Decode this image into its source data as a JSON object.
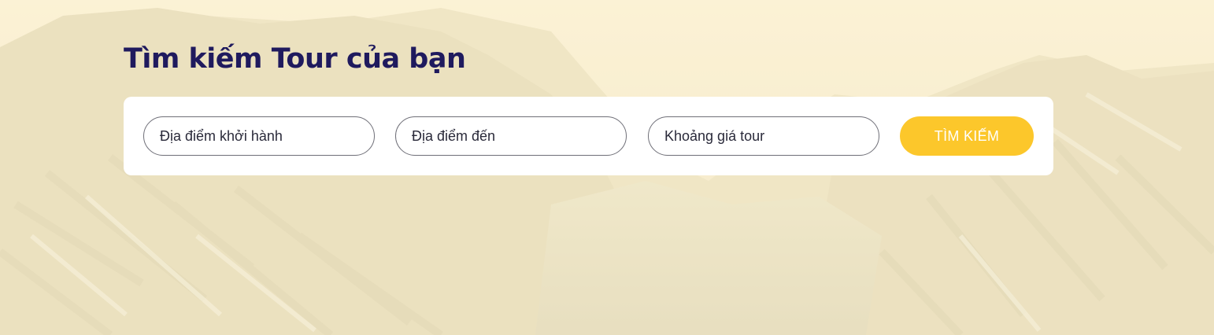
{
  "hero": {
    "heading": "Tìm kiếm Tour của bạn"
  },
  "search": {
    "departure_placeholder": "Địa điểm khởi hành",
    "destination_placeholder": "Địa điểm đến",
    "price_placeholder": "Khoảng giá tour",
    "button_label": "TÌM KIẾM"
  },
  "colors": {
    "heading": "#1f1a5e",
    "button": "#fcc72b",
    "overlay": "#fdf3d4"
  }
}
